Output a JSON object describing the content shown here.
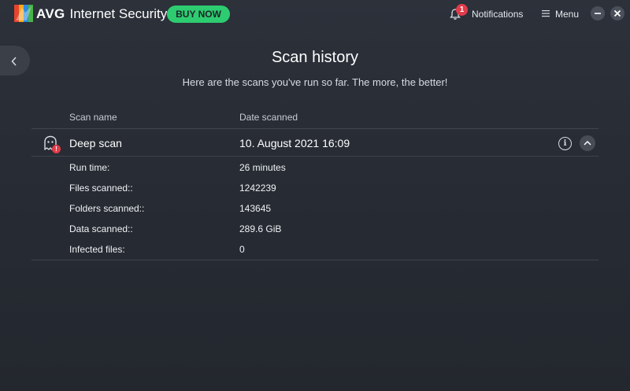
{
  "header": {
    "brand_short": "AVG",
    "brand_product": "Internet Security",
    "buy_now_label": "BUY NOW",
    "notifications_count": "1",
    "notifications_label": "Notifications",
    "menu_label": "Menu",
    "minimize_icon": "minimize-icon",
    "close_icon": "close-icon"
  },
  "colors": {
    "buy_now": "#2dcc70",
    "badge": "#e23b4a",
    "background": "#2a2e36"
  },
  "page": {
    "title": "Scan history",
    "subtitle": "Here are the scans you've run so far. The more, the better!"
  },
  "table": {
    "columns": [
      "Scan name",
      "Date scanned"
    ],
    "scans": [
      {
        "icon": "ghost-icon",
        "badge": "!",
        "name": "Deep scan",
        "date": "10. August 2021 16:09",
        "expanded": true,
        "details": [
          {
            "label": "Run time:",
            "value": "26 minutes"
          },
          {
            "label": "Files scanned::",
            "value": "1242239"
          },
          {
            "label": "Folders scanned::",
            "value": "143645"
          },
          {
            "label": "Data scanned::",
            "value": "289.6 GiB"
          },
          {
            "label": "Infected files:",
            "value": "0"
          }
        ]
      }
    ]
  }
}
